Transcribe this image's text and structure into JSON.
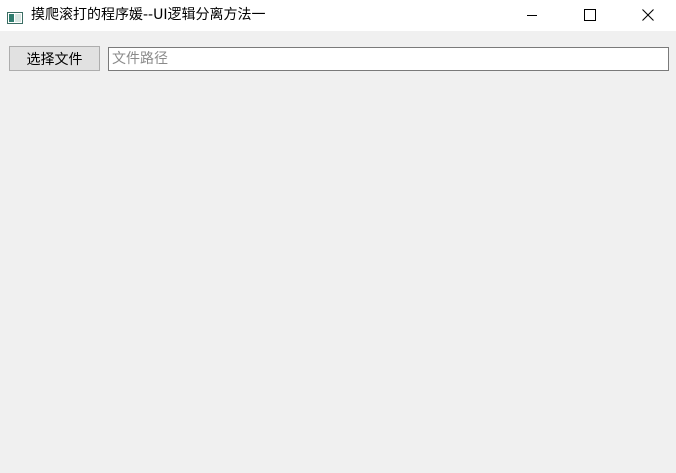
{
  "window": {
    "title": "摸爬滚打的程序媛--UI逻辑分离方法一",
    "icon": "app-window-icon",
    "controls": {
      "minimize_icon": "minimize-icon",
      "maximize_icon": "maximize-icon",
      "close_icon": "close-icon"
    }
  },
  "toolbar": {
    "select_button_label": "选择文件",
    "path_input": {
      "value": "",
      "placeholder": "文件路径"
    }
  },
  "colors": {
    "titlebar_bg": "#ffffff",
    "content_bg": "#f0f0f0",
    "button_bg": "#e1e1e1",
    "button_border": "#adadad",
    "input_border": "#7a7a7a",
    "placeholder_text": "#8a8a8a"
  }
}
